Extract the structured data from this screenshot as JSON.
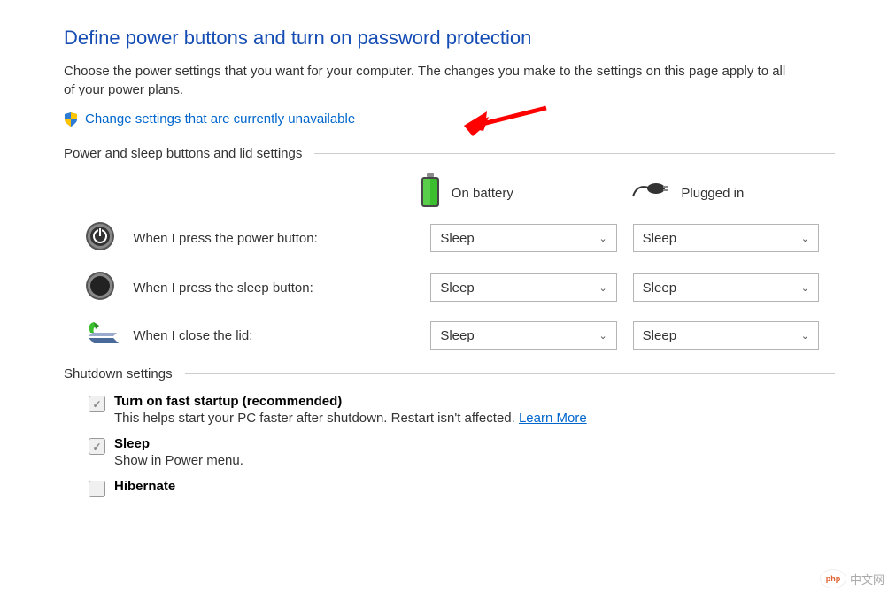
{
  "header": {
    "title": "Define power buttons and turn on password protection",
    "description": "Choose the power settings that you want for your computer. The changes you make to the settings on this page apply to all of your power plans.",
    "change_link": "Change settings that are currently unavailable"
  },
  "section1": {
    "title": "Power and sleep buttons and lid settings",
    "col_battery": "On battery",
    "col_plugged": "Plugged in",
    "rows": [
      {
        "label": "When I press the power button:",
        "battery": "Sleep",
        "plugged": "Sleep"
      },
      {
        "label": "When I press the sleep button:",
        "battery": "Sleep",
        "plugged": "Sleep"
      },
      {
        "label": "When I close the lid:",
        "battery": "Sleep",
        "plugged": "Sleep"
      }
    ]
  },
  "section2": {
    "title": "Shutdown settings",
    "settings": [
      {
        "title": "Turn on fast startup (recommended)",
        "sub": "This helps start your PC faster after shutdown. Restart isn't affected.",
        "learn": "Learn More",
        "checked": true
      },
      {
        "title": "Sleep",
        "sub": "Show in Power menu.",
        "checked": true
      },
      {
        "title": "Hibernate",
        "checked": false
      }
    ]
  },
  "watermark": "中文网"
}
